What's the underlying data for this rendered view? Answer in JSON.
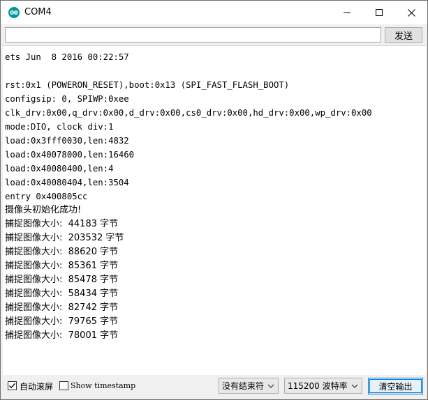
{
  "window": {
    "title": "COM4"
  },
  "send_row": {
    "input_value": "",
    "send_label": "发送"
  },
  "console": {
    "lines": [
      "ets Jun  8 2016 00:22:57",
      "",
      "rst:0x1 (POWERON_RESET),boot:0x13 (SPI_FAST_FLASH_BOOT)",
      "configsip: 0, SPIWP:0xee",
      "clk_drv:0x00,q_drv:0x00,d_drv:0x00,cs0_drv:0x00,hd_drv:0x00,wp_drv:0x00",
      "mode:DIO, clock div:1",
      "load:0x3fff0030,len:4832",
      "load:0x40078000,len:16460",
      "load:0x40080400,len:4",
      "load:0x40080404,len:3504",
      "entry 0x400805cc",
      "摄像头初始化成功!",
      "捕捉图像大小:  44183 字节",
      "捕捉图像大小:  203532 字节",
      "捕捉图像大小:  88620 字节",
      "捕捉图像大小:  85361 字节",
      "捕捉图像大小:  85478 字节",
      "捕捉图像大小:  58434 字节",
      "捕捉图像大小:  82742 字节",
      "捕捉图像大小:  79765 字节",
      "捕捉图像大小:  78001 字节"
    ]
  },
  "bottom_bar": {
    "autoscroll_label": "自动滚屏",
    "autoscroll_checked": true,
    "timestamp_label": "Show timestamp",
    "timestamp_checked": false,
    "line_ending_value": "没有结束符",
    "baud_value": "115200 波特率",
    "clear_label": "清空输出"
  },
  "icons": {
    "app": "arduino-icon",
    "minimize": "minimize-icon",
    "maximize": "maximize-icon",
    "close": "close-icon",
    "check": "check-icon",
    "dropdown": "chevron-down-icon"
  },
  "colors": {
    "arduino_teal": "#00979c",
    "focus_blue": "#0078d7"
  }
}
